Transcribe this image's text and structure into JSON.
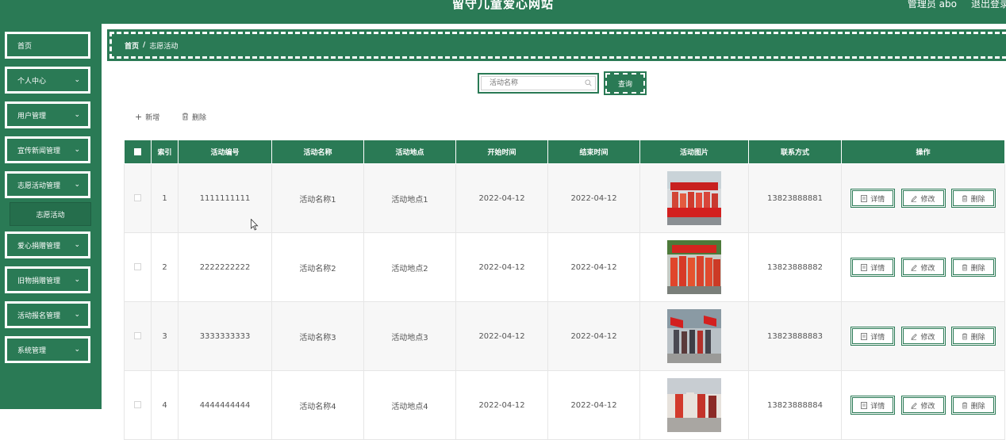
{
  "header": {
    "title": "留守儿童爱心网站",
    "user_label": "管理员 abo",
    "logout_label": "退出登录"
  },
  "sidebar": {
    "items": [
      {
        "label": "首页",
        "has_chevron": false
      },
      {
        "label": "个人中心",
        "has_chevron": true
      },
      {
        "label": "用户管理",
        "has_chevron": true
      },
      {
        "label": "宣传新闻管理",
        "has_chevron": true
      },
      {
        "label": "志愿活动管理",
        "has_chevron": true
      },
      {
        "label": "爱心捐赠管理",
        "has_chevron": true
      },
      {
        "label": "旧物捐赠管理",
        "has_chevron": true
      },
      {
        "label": "活动报名管理",
        "has_chevron": true
      },
      {
        "label": "系统管理",
        "has_chevron": true
      }
    ],
    "submenu": {
      "label": "志愿活动"
    }
  },
  "breadcrumb": {
    "home": "首页",
    "separator": "/",
    "current": "志愿活动"
  },
  "search": {
    "placeholder": "活动名称",
    "value": "",
    "button_label": "查询"
  },
  "toolbar": {
    "add_label": "新增",
    "delete_label": "删除"
  },
  "table": {
    "headers": [
      "索引",
      "活动编号",
      "活动名称",
      "活动地点",
      "开始时间",
      "结束时间",
      "活动图片",
      "联系方式",
      "操作"
    ],
    "rows": [
      {
        "index": "1",
        "code": "1111111111",
        "name": "活动名称1",
        "place": "活动地点1",
        "start": "2022-04-12",
        "end": "2022-04-12",
        "phone": "13823888881"
      },
      {
        "index": "2",
        "code": "2222222222",
        "name": "活动名称2",
        "place": "活动地点2",
        "start": "2022-04-12",
        "end": "2022-04-12",
        "phone": "13823888882"
      },
      {
        "index": "3",
        "code": "3333333333",
        "name": "活动名称3",
        "place": "活动地点3",
        "start": "2022-04-12",
        "end": "2022-04-12",
        "phone": "13823888883"
      },
      {
        "index": "4",
        "code": "4444444444",
        "name": "活动名称4",
        "place": "活动地点4",
        "start": "2022-04-12",
        "end": "2022-04-12",
        "phone": "13823888884"
      }
    ],
    "actions": {
      "detail_label": "详情",
      "edit_label": "修改",
      "delete_label": "删除"
    }
  },
  "colors": {
    "primary": "#2a7a55",
    "white": "#ffffff"
  }
}
